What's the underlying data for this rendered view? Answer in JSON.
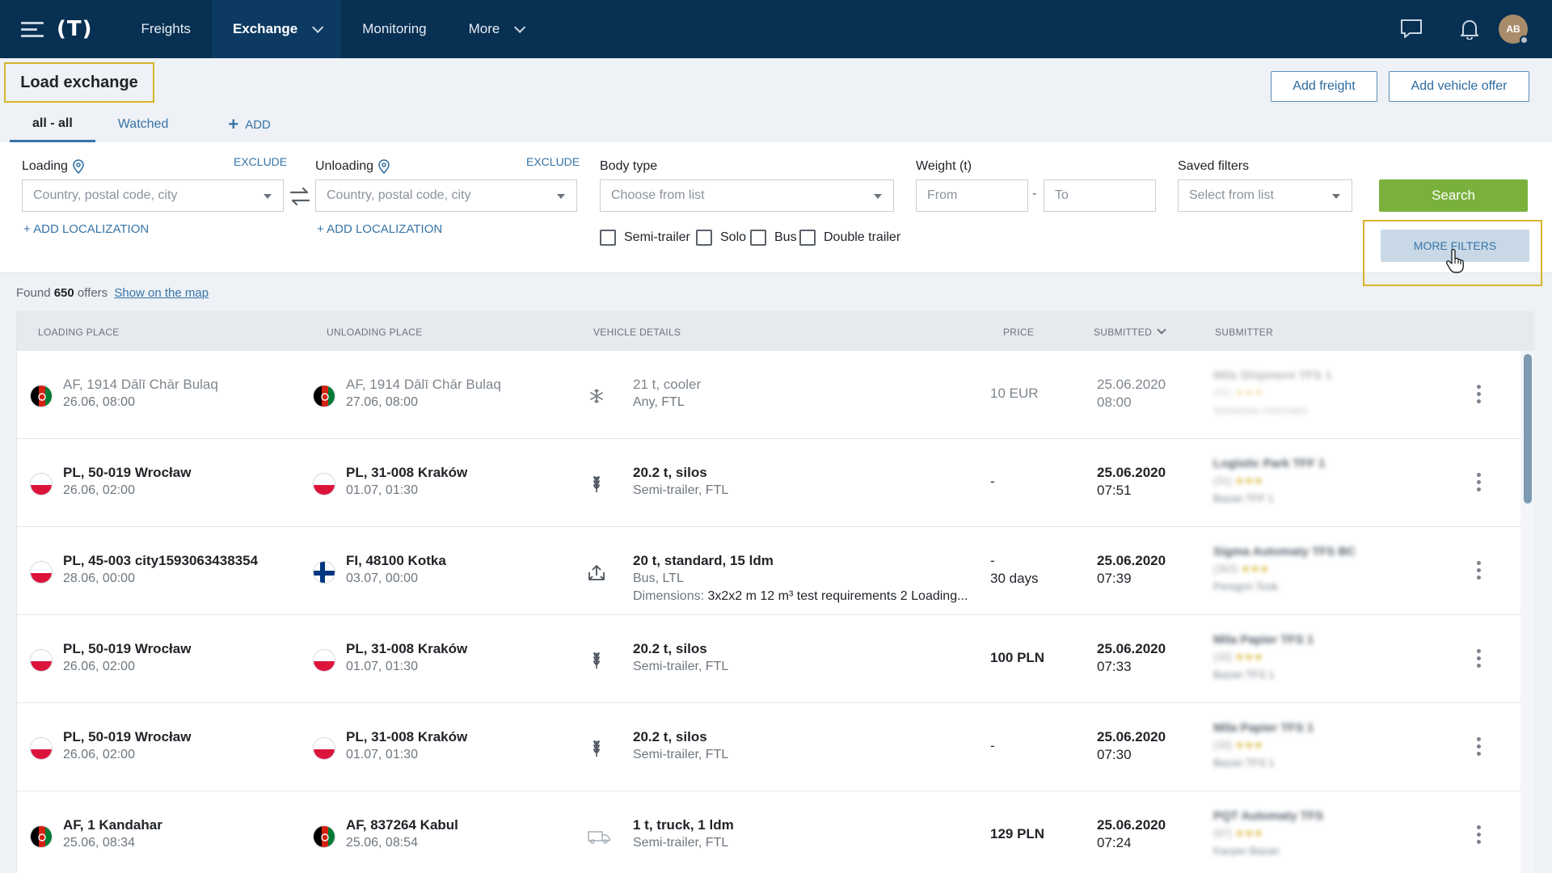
{
  "nav": {
    "logo": "(T)",
    "items": [
      {
        "label": "Freights"
      },
      {
        "label": "Exchange"
      },
      {
        "label": "Monitoring"
      },
      {
        "label": "More"
      }
    ],
    "avatar_initials": "AB"
  },
  "header": {
    "title": "Load exchange",
    "tabs": [
      {
        "label": "all - all"
      },
      {
        "label": "Watched"
      }
    ],
    "add_tab_label": "ADD",
    "add_freight_label": "Add freight",
    "add_vehicle_offer_label": "Add vehicle offer"
  },
  "filters": {
    "loading": {
      "label": "Loading",
      "exclude": "EXCLUDE",
      "placeholder": "Country, postal code, city",
      "add_localization": "ADD LOCALIZATION"
    },
    "unloading": {
      "label": "Unloading",
      "exclude": "EXCLUDE",
      "placeholder": "Country, postal code, city",
      "add_localization": "ADD LOCALIZATION"
    },
    "body_type": {
      "label": "Body type",
      "placeholder": "Choose from list",
      "options": [
        "Semi-trailer",
        "Solo",
        "Bus",
        "Double trailer"
      ]
    },
    "weight": {
      "label": "Weight (t)",
      "from_placeholder": "From",
      "separator": "-",
      "to_placeholder": "To"
    },
    "saved": {
      "label": "Saved filters",
      "placeholder": "Select from list"
    },
    "search_label": "Search",
    "more_filters_label": "MORE FILTERS"
  },
  "results": {
    "found_prefix": "Found",
    "count": "650",
    "offers_label": "offers",
    "map_link": "Show on the map"
  },
  "table": {
    "columns": [
      "LOADING PLACE",
      "UNLOADING PLACE",
      "VEHICLE DETAILS",
      "PRICE",
      "SUBMITTED",
      "SUBMITTER"
    ],
    "rows": [
      {
        "from_flag": "af",
        "from_place": "AF, 1914 Dālī Chār Bulaq",
        "from_date": "26.06, 08:00",
        "to_flag": "af",
        "to_place": "AF, 1914 Dālī Chār Bulaq",
        "to_date": "27.06, 08:00",
        "vehicle_icon": "snowflake-icon",
        "vehicle_main": "21 t, cooler",
        "vehicle_sub": "Any, FTL",
        "vehicle_extra": "",
        "price": "10 EUR",
        "price_sub": "",
        "submitted_date": "25.06.2020",
        "submitted_time": "08:00",
        "sub_company": "Mila Shipment TFS 1",
        "sub_rating": "(56)",
        "sub_person": "Sebastian Gonzalez",
        "dim": true
      },
      {
        "from_flag": "pl",
        "from_place": "PL, 50-019 Wrocław",
        "from_date": "26.06, 02:00",
        "to_flag": "pl",
        "to_place": "PL, 31-008 Kraków",
        "to_date": "01.07, 01:30",
        "vehicle_icon": "wheat-icon",
        "vehicle_main": "20.2 t, silos",
        "vehicle_sub": "Semi-trailer, FTL",
        "vehicle_extra": "",
        "price": "-",
        "price_sub": "",
        "submitted_date": "25.06.2020",
        "submitted_time": "07:51",
        "sub_company": "Logistic Park TFF 1",
        "sub_rating": "(31)",
        "sub_person": "Bazan TFF 1",
        "dim": false
      },
      {
        "from_flag": "pl",
        "from_place": "PL, 45-003 city1593063438354",
        "from_date": "28.06, 00:00",
        "to_flag": "fi",
        "to_place": "FI, 48100 Kotka",
        "to_date": "03.07, 00:00",
        "vehicle_icon": "box-upload-icon",
        "vehicle_main": "20 t, standard, 15 ldm",
        "vehicle_sub": "Bus, LTL",
        "vehicle_extra": "Dimensions: 3x2x2 m 12 m³ test requirements 2 Loading...",
        "price": "-",
        "price_sub": "30 days",
        "submitted_date": "25.06.2020",
        "submitted_time": "07:39",
        "sub_company": "Sigma Automaty TFS BC",
        "sub_rating": "(363)",
        "sub_person": "Peregrin Took",
        "dim": false
      },
      {
        "from_flag": "pl",
        "from_place": "PL, 50-019 Wrocław",
        "from_date": "26.06, 02:00",
        "to_flag": "pl",
        "to_place": "PL, 31-008 Kraków",
        "to_date": "01.07, 01:30",
        "vehicle_icon": "wheat-icon",
        "vehicle_main": "20.2 t, silos",
        "vehicle_sub": "Semi-trailer, FTL",
        "vehicle_extra": "",
        "price": "100 PLN",
        "price_sub": "",
        "submitted_date": "25.06.2020",
        "submitted_time": "07:33",
        "sub_company": "Mila Papier TFS 1",
        "sub_rating": "(33)",
        "sub_person": "Bazan TFS 1",
        "dim": false
      },
      {
        "from_flag": "pl",
        "from_place": "PL, 50-019 Wrocław",
        "from_date": "26.06, 02:00",
        "to_flag": "pl",
        "to_place": "PL, 31-008 Kraków",
        "to_date": "01.07, 01:30",
        "vehicle_icon": "wheat-icon",
        "vehicle_main": "20.2 t, silos",
        "vehicle_sub": "Semi-trailer, FTL",
        "vehicle_extra": "",
        "price": "-",
        "price_sub": "",
        "submitted_date": "25.06.2020",
        "submitted_time": "07:30",
        "sub_company": "Mila Papier TFS 1",
        "sub_rating": "(33)",
        "sub_person": "Bazan TFS 1",
        "dim": false
      },
      {
        "from_flag": "af",
        "from_place": "AF, 1 Kandahar",
        "from_date": "25.06, 08:34",
        "to_flag": "af",
        "to_place": "AF, 837264 Kabul",
        "to_date": "25.06, 08:54",
        "vehicle_icon": "truck-icon",
        "vehicle_main": "1 t, truck, 1 ldm",
        "vehicle_sub": "Semi-trailer, FTL",
        "vehicle_extra": "",
        "price": "129 PLN",
        "price_sub": "",
        "submitted_date": "25.06.2020",
        "submitted_time": "07:24",
        "sub_company": "PQT Automaty TFS",
        "sub_rating": "(67)",
        "sub_person": "Kacper Bazan",
        "dim": false
      }
    ]
  },
  "colors": {
    "nav_bg": "#083052",
    "accent_blue": "#3674a8",
    "search_green": "#7ab13c",
    "highlight_yellow": "#d7b42c"
  }
}
